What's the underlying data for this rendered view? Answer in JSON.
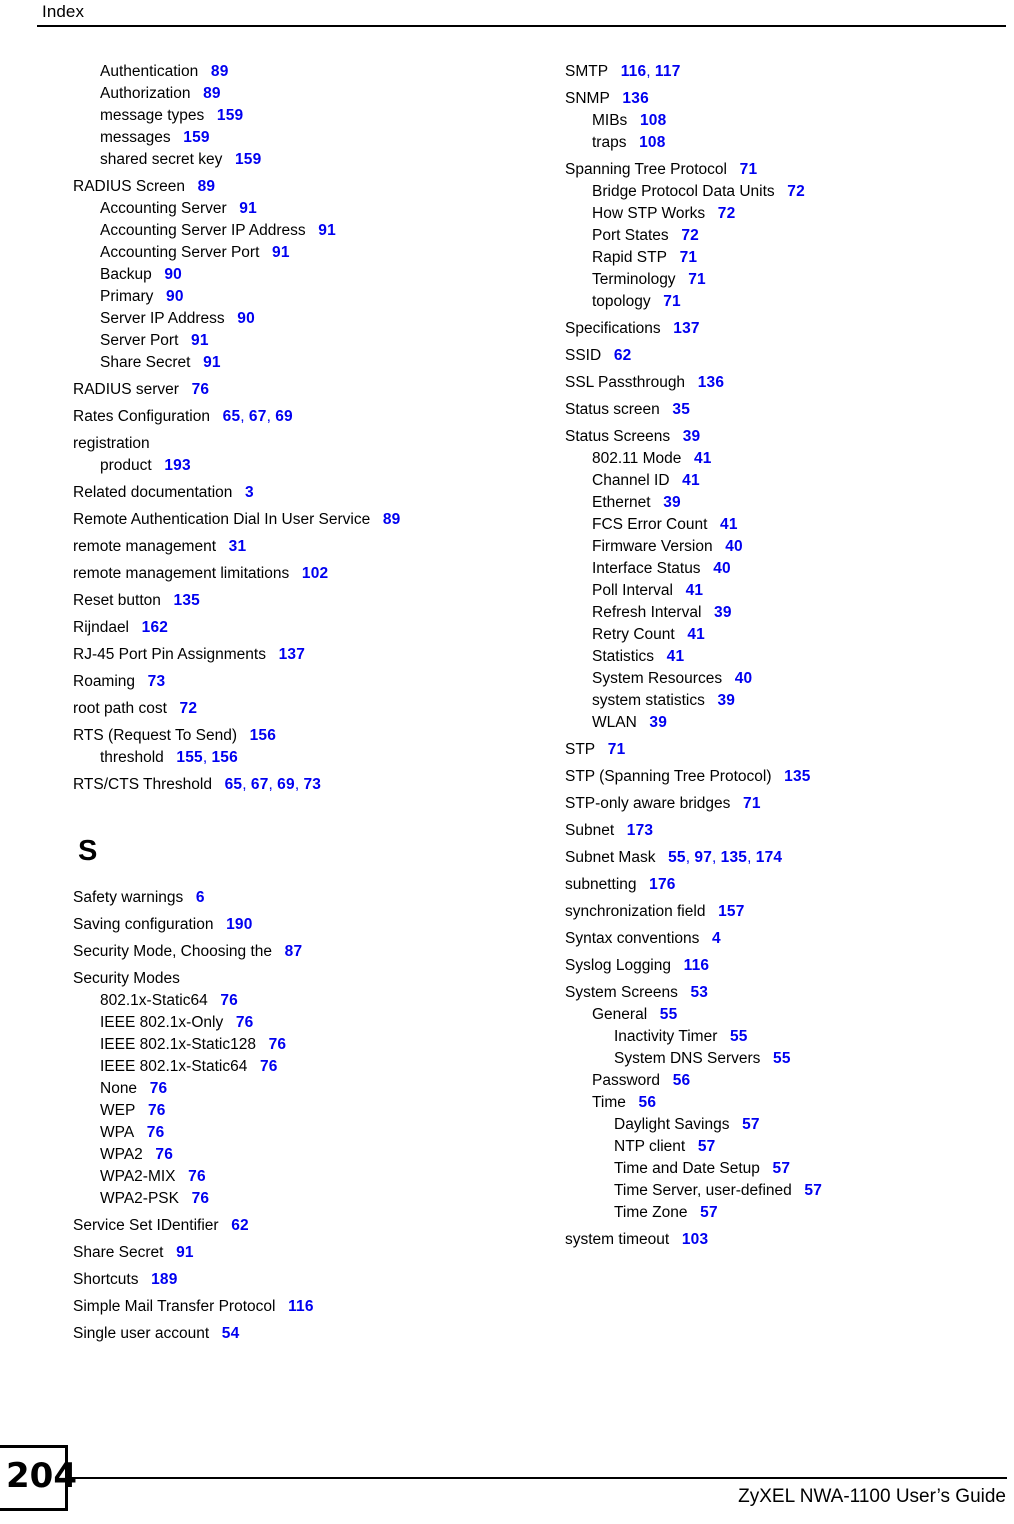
{
  "header": {
    "title": "Index"
  },
  "footer": {
    "page_number": "204",
    "guide_title": "ZyXEL NWA-1100 User’s Guide"
  },
  "colors": {
    "page_reference": "#0000F0",
    "text": "#000000",
    "background": "#FFFFFF"
  },
  "columns": {
    "left": [
      {
        "type": "entry",
        "level": 2,
        "term": "Authentication",
        "pages": [
          "89"
        ]
      },
      {
        "type": "entry",
        "level": 2,
        "term": "Authorization",
        "pages": [
          "89"
        ]
      },
      {
        "type": "entry",
        "level": 2,
        "term": "message types",
        "pages": [
          "159"
        ]
      },
      {
        "type": "entry",
        "level": 2,
        "term": "messages",
        "pages": [
          "159"
        ]
      },
      {
        "type": "entry",
        "level": 2,
        "term": "shared secret key",
        "pages": [
          "159"
        ]
      },
      {
        "type": "entry",
        "level": 1,
        "term": "RADIUS Screen",
        "pages": [
          "89"
        ]
      },
      {
        "type": "entry",
        "level": 2,
        "term": "Accounting Server",
        "pages": [
          "91"
        ]
      },
      {
        "type": "entry",
        "level": 2,
        "term": "Accounting Server IP Address",
        "pages": [
          "91"
        ]
      },
      {
        "type": "entry",
        "level": 2,
        "term": "Accounting Server Port",
        "pages": [
          "91"
        ]
      },
      {
        "type": "entry",
        "level": 2,
        "term": "Backup",
        "pages": [
          "90"
        ]
      },
      {
        "type": "entry",
        "level": 2,
        "term": "Primary",
        "pages": [
          "90"
        ]
      },
      {
        "type": "entry",
        "level": 2,
        "term": "Server IP Address",
        "pages": [
          "90"
        ]
      },
      {
        "type": "entry",
        "level": 2,
        "term": "Server Port",
        "pages": [
          "91"
        ]
      },
      {
        "type": "entry",
        "level": 2,
        "term": "Share Secret",
        "pages": [
          "91"
        ]
      },
      {
        "type": "entry",
        "level": 1,
        "term": "RADIUS server",
        "pages": [
          "76"
        ]
      },
      {
        "type": "entry",
        "level": 1,
        "term": "Rates Configuration",
        "pages": [
          "65",
          "67",
          "69"
        ]
      },
      {
        "type": "entry",
        "level": 1,
        "term": "registration",
        "pages": []
      },
      {
        "type": "entry",
        "level": 2,
        "term": "product",
        "pages": [
          "193"
        ]
      },
      {
        "type": "entry",
        "level": 1,
        "term": "Related documentation",
        "pages": [
          "3"
        ]
      },
      {
        "type": "entry",
        "level": 1,
        "term": "Remote Authentication Dial In User Service",
        "pages": [
          "89"
        ]
      },
      {
        "type": "entry",
        "level": 1,
        "term": "remote management",
        "pages": [
          "31"
        ]
      },
      {
        "type": "entry",
        "level": 1,
        "term": "remote management limitations",
        "pages": [
          "102"
        ]
      },
      {
        "type": "entry",
        "level": 1,
        "term": "Reset button",
        "pages": [
          "135"
        ]
      },
      {
        "type": "entry",
        "level": 1,
        "term": "Rijndael",
        "pages": [
          "162"
        ]
      },
      {
        "type": "entry",
        "level": 1,
        "term": "RJ-45 Port Pin Assignments",
        "pages": [
          "137"
        ]
      },
      {
        "type": "entry",
        "level": 1,
        "term": "Roaming",
        "pages": [
          "73"
        ]
      },
      {
        "type": "entry",
        "level": 1,
        "term": "root path cost",
        "pages": [
          "72"
        ]
      },
      {
        "type": "entry",
        "level": 1,
        "term": "RTS (Request To Send)",
        "pages": [
          "156"
        ]
      },
      {
        "type": "entry",
        "level": 2,
        "term": "threshold",
        "pages": [
          "155",
          "156"
        ]
      },
      {
        "type": "entry",
        "level": 1,
        "term": "RTS/CTS Threshold",
        "pages": [
          "65",
          "67",
          "69",
          "73"
        ]
      },
      {
        "type": "heading",
        "letter": "S"
      },
      {
        "type": "entry",
        "level": 1,
        "term": "Safety warnings",
        "pages": [
          "6"
        ]
      },
      {
        "type": "entry",
        "level": 1,
        "term": "Saving configuration",
        "pages": [
          "190"
        ]
      },
      {
        "type": "entry",
        "level": 1,
        "term": "Security Mode, Choosing the",
        "pages": [
          "87"
        ]
      },
      {
        "type": "entry",
        "level": 1,
        "term": "Security Modes",
        "pages": []
      },
      {
        "type": "entry",
        "level": 2,
        "term": "802.1x-Static64",
        "pages": [
          "76"
        ]
      },
      {
        "type": "entry",
        "level": 2,
        "term": "IEEE 802.1x-Only",
        "pages": [
          "76"
        ]
      },
      {
        "type": "entry",
        "level": 2,
        "term": "IEEE 802.1x-Static128",
        "pages": [
          "76"
        ]
      },
      {
        "type": "entry",
        "level": 2,
        "term": "IEEE 802.1x-Static64",
        "pages": [
          "76"
        ]
      },
      {
        "type": "entry",
        "level": 2,
        "term": "None",
        "pages": [
          "76"
        ]
      },
      {
        "type": "entry",
        "level": 2,
        "term": "WEP",
        "pages": [
          "76"
        ]
      },
      {
        "type": "entry",
        "level": 2,
        "term": "WPA",
        "pages": [
          "76"
        ]
      },
      {
        "type": "entry",
        "level": 2,
        "term": "WPA2",
        "pages": [
          "76"
        ]
      },
      {
        "type": "entry",
        "level": 2,
        "term": "WPA2-MIX",
        "pages": [
          "76"
        ]
      },
      {
        "type": "entry",
        "level": 2,
        "term": "WPA2-PSK",
        "pages": [
          "76"
        ]
      },
      {
        "type": "entry",
        "level": 1,
        "term": "Service Set IDentifier",
        "pages": [
          "62"
        ]
      },
      {
        "type": "entry",
        "level": 1,
        "term": "Share Secret",
        "pages": [
          "91"
        ]
      },
      {
        "type": "entry",
        "level": 1,
        "term": "Shortcuts",
        "pages": [
          "189"
        ]
      },
      {
        "type": "entry",
        "level": 1,
        "term": "Simple Mail Transfer Protocol",
        "pages": [
          "116"
        ]
      },
      {
        "type": "entry",
        "level": 1,
        "term": "Single user account",
        "pages": [
          "54"
        ]
      }
    ],
    "right": [
      {
        "type": "entry",
        "level": 1,
        "term": "SMTP",
        "pages": [
          "116",
          "117"
        ]
      },
      {
        "type": "entry",
        "level": 1,
        "term": "SNMP",
        "pages": [
          "136"
        ]
      },
      {
        "type": "entry",
        "level": 2,
        "term": "MIBs",
        "pages": [
          "108"
        ]
      },
      {
        "type": "entry",
        "level": 2,
        "term": "traps",
        "pages": [
          "108"
        ]
      },
      {
        "type": "entry",
        "level": 1,
        "term": "Spanning Tree Protocol",
        "pages": [
          "71"
        ]
      },
      {
        "type": "entry",
        "level": 2,
        "term": "Bridge Protocol Data Units",
        "pages": [
          "72"
        ]
      },
      {
        "type": "entry",
        "level": 2,
        "term": "How STP Works",
        "pages": [
          "72"
        ]
      },
      {
        "type": "entry",
        "level": 2,
        "term": "Port States",
        "pages": [
          "72"
        ]
      },
      {
        "type": "entry",
        "level": 2,
        "term": "Rapid STP",
        "pages": [
          "71"
        ]
      },
      {
        "type": "entry",
        "level": 2,
        "term": "Terminology",
        "pages": [
          "71"
        ]
      },
      {
        "type": "entry",
        "level": 2,
        "term": "topology",
        "pages": [
          "71"
        ]
      },
      {
        "type": "entry",
        "level": 1,
        "term": "Specifications",
        "pages": [
          "137"
        ]
      },
      {
        "type": "entry",
        "level": 1,
        "term": "SSID",
        "pages": [
          "62"
        ]
      },
      {
        "type": "entry",
        "level": 1,
        "term": "SSL Passthrough",
        "pages": [
          "136"
        ]
      },
      {
        "type": "entry",
        "level": 1,
        "term": "Status screen",
        "pages": [
          "35"
        ]
      },
      {
        "type": "entry",
        "level": 1,
        "term": "Status Screens",
        "pages": [
          "39"
        ]
      },
      {
        "type": "entry",
        "level": 2,
        "term": "802.11 Mode",
        "pages": [
          "41"
        ]
      },
      {
        "type": "entry",
        "level": 2,
        "term": "Channel ID",
        "pages": [
          "41"
        ]
      },
      {
        "type": "entry",
        "level": 2,
        "term": "Ethernet",
        "pages": [
          "39"
        ]
      },
      {
        "type": "entry",
        "level": 2,
        "term": "FCS Error Count",
        "pages": [
          "41"
        ]
      },
      {
        "type": "entry",
        "level": 2,
        "term": "Firmware Version",
        "pages": [
          "40"
        ]
      },
      {
        "type": "entry",
        "level": 2,
        "term": "Interface Status",
        "pages": [
          "40"
        ]
      },
      {
        "type": "entry",
        "level": 2,
        "term": "Poll Interval",
        "pages": [
          "41"
        ]
      },
      {
        "type": "entry",
        "level": 2,
        "term": "Refresh Interval",
        "pages": [
          "39"
        ]
      },
      {
        "type": "entry",
        "level": 2,
        "term": "Retry Count",
        "pages": [
          "41"
        ]
      },
      {
        "type": "entry",
        "level": 2,
        "term": "Statistics",
        "pages": [
          "41"
        ]
      },
      {
        "type": "entry",
        "level": 2,
        "term": "System Resources",
        "pages": [
          "40"
        ]
      },
      {
        "type": "entry",
        "level": 2,
        "term": "system statistics",
        "pages": [
          "39"
        ]
      },
      {
        "type": "entry",
        "level": 2,
        "term": "WLAN",
        "pages": [
          "39"
        ]
      },
      {
        "type": "entry",
        "level": 1,
        "term": "STP",
        "pages": [
          "71"
        ]
      },
      {
        "type": "entry",
        "level": 1,
        "term": "STP (Spanning Tree Protocol)",
        "pages": [
          "135"
        ]
      },
      {
        "type": "entry",
        "level": 1,
        "term": "STP-only aware bridges",
        "pages": [
          "71"
        ]
      },
      {
        "type": "entry",
        "level": 1,
        "term": "Subnet",
        "pages": [
          "173"
        ]
      },
      {
        "type": "entry",
        "level": 1,
        "term": "Subnet Mask",
        "pages": [
          "55",
          "97",
          "135",
          "174"
        ]
      },
      {
        "type": "entry",
        "level": 1,
        "term": "subnetting",
        "pages": [
          "176"
        ]
      },
      {
        "type": "entry",
        "level": 1,
        "term": "synchronization field",
        "pages": [
          "157"
        ]
      },
      {
        "type": "entry",
        "level": 1,
        "term": "Syntax conventions",
        "pages": [
          "4"
        ]
      },
      {
        "type": "entry",
        "level": 1,
        "term": "Syslog Logging",
        "pages": [
          "116"
        ]
      },
      {
        "type": "entry",
        "level": 1,
        "term": "System Screens",
        "pages": [
          "53"
        ]
      },
      {
        "type": "entry",
        "level": 2,
        "term": "General",
        "pages": [
          "55"
        ]
      },
      {
        "type": "entry",
        "level": 3,
        "term": "Inactivity Timer",
        "pages": [
          "55"
        ]
      },
      {
        "type": "entry",
        "level": 3,
        "term": "System DNS Servers",
        "pages": [
          "55"
        ]
      },
      {
        "type": "entry",
        "level": 2,
        "term": "Password",
        "pages": [
          "56"
        ]
      },
      {
        "type": "entry",
        "level": 2,
        "term": "Time",
        "pages": [
          "56"
        ]
      },
      {
        "type": "entry",
        "level": 3,
        "term": "Daylight Savings",
        "pages": [
          "57"
        ]
      },
      {
        "type": "entry",
        "level": 3,
        "term": "NTP client",
        "pages": [
          "57"
        ]
      },
      {
        "type": "entry",
        "level": 3,
        "term": "Time and Date Setup",
        "pages": [
          "57"
        ]
      },
      {
        "type": "entry",
        "level": 3,
        "term": "Time Server, user-defined",
        "pages": [
          "57"
        ]
      },
      {
        "type": "entry",
        "level": 3,
        "term": "Time Zone",
        "pages": [
          "57"
        ]
      },
      {
        "type": "entry",
        "level": 1,
        "term": "system timeout",
        "pages": [
          "103"
        ]
      }
    ]
  }
}
